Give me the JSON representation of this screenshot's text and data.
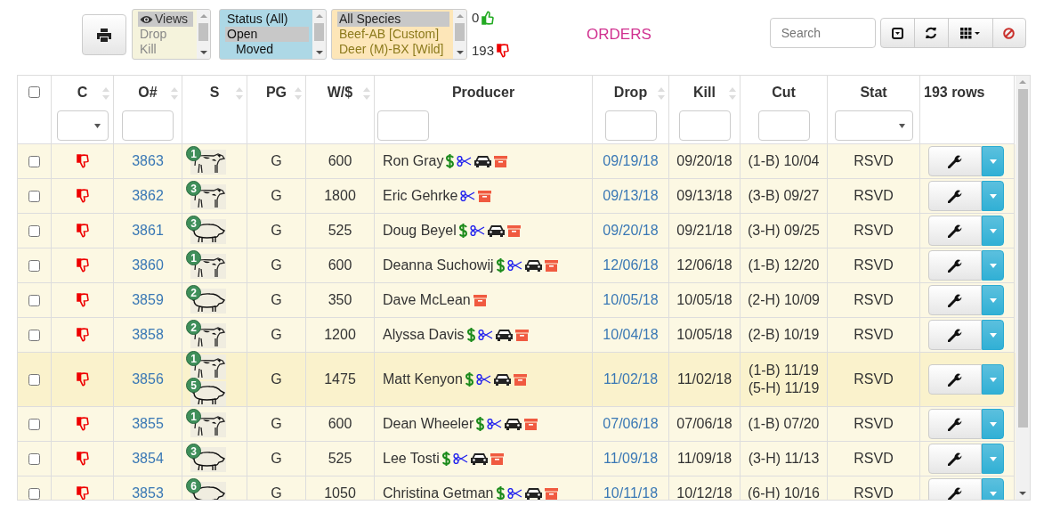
{
  "toolbar": {
    "views": [
      {
        "label": "Views",
        "selected": true
      },
      {
        "label": "Drop",
        "selected": false
      },
      {
        "label": "Kill",
        "selected": false
      }
    ],
    "statuses": [
      {
        "label": "Status (All)",
        "selected": false,
        "indented": false
      },
      {
        "label": "Open",
        "selected": true,
        "indented": false
      },
      {
        "label": "Moved",
        "selected": false,
        "indented": true
      }
    ],
    "species": [
      {
        "label": "All Species",
        "selected": true
      },
      {
        "label": "Beef-AB [Custom]",
        "selected": false
      },
      {
        "label": "Deer (M)-BX [Wild]",
        "selected": false
      }
    ],
    "approved_count": "0",
    "rejected_count": "193",
    "title": "ORDERS",
    "search": {
      "placeholder": "Search"
    }
  },
  "table": {
    "select_all": {
      "checked": false
    },
    "columns": [
      {
        "label": "C",
        "sortable": true,
        "filter": {
          "kind": "select"
        }
      },
      {
        "label": "O#",
        "sortable": true,
        "filter": {
          "kind": "text"
        }
      },
      {
        "label": "S",
        "sortable": true
      },
      {
        "label": "PG",
        "sortable": true
      },
      {
        "label": "W/$",
        "sortable": true
      },
      {
        "label": "Producer",
        "sortable": false,
        "filter": {
          "kind": "text"
        }
      },
      {
        "label": "Drop",
        "sortable": true,
        "filter": {
          "kind": "text"
        }
      },
      {
        "label": "Kill",
        "sortable": true,
        "filter": {
          "kind": "text"
        }
      },
      {
        "label": "Cut",
        "sortable": false,
        "filter": {
          "kind": "text"
        }
      },
      {
        "label": "Stat",
        "sortable": false,
        "filter": {
          "kind": "select"
        }
      },
      {
        "label": "193 rows",
        "sortable": false
      }
    ],
    "rows": [
      {
        "checked": false,
        "highlighted": false,
        "order": "3863",
        "animals": [
          {
            "kind": "cow",
            "count": "1"
          }
        ],
        "pg": "G",
        "weight": "600",
        "producer": "Ron Gray",
        "flags": {
          "dollar": true,
          "scissors": true,
          "car": true,
          "box": true
        },
        "drop": "09/19/18",
        "kill": "09/20/18",
        "cuts": [
          "(1-B) 10/04"
        ],
        "stat": "RSVD"
      },
      {
        "checked": false,
        "highlighted": false,
        "order": "3862",
        "animals": [
          {
            "kind": "cow",
            "count": "3"
          }
        ],
        "pg": "G",
        "weight": "1800",
        "producer": "Eric Gehrke",
        "flags": {
          "dollar": false,
          "scissors": true,
          "car": false,
          "box": true
        },
        "drop": "09/13/18",
        "kill": "09/13/18",
        "cuts": [
          "(3-B) 09/27"
        ],
        "stat": "RSVD"
      },
      {
        "checked": false,
        "highlighted": false,
        "order": "3861",
        "animals": [
          {
            "kind": "pig",
            "count": "3"
          }
        ],
        "pg": "G",
        "weight": "525",
        "producer": "Doug Beyel",
        "flags": {
          "dollar": true,
          "scissors": true,
          "car": true,
          "box": true
        },
        "drop": "09/20/18",
        "kill": "09/21/18",
        "cuts": [
          "(3-H) 09/25"
        ],
        "stat": "RSVD"
      },
      {
        "checked": false,
        "highlighted": false,
        "order": "3860",
        "animals": [
          {
            "kind": "cow",
            "count": "1"
          }
        ],
        "pg": "G",
        "weight": "600",
        "producer": "Deanna Suchowij",
        "flags": {
          "dollar": true,
          "scissors": true,
          "car": true,
          "box": true
        },
        "drop": "12/06/18",
        "kill": "12/06/18",
        "cuts": [
          "(1-B) 12/20"
        ],
        "stat": "RSVD"
      },
      {
        "checked": false,
        "highlighted": false,
        "order": "3859",
        "animals": [
          {
            "kind": "pig",
            "count": "2"
          }
        ],
        "pg": "G",
        "weight": "350",
        "producer": "Dave McLean",
        "flags": {
          "dollar": false,
          "scissors": false,
          "car": false,
          "box": true
        },
        "drop": "10/05/18",
        "kill": "10/05/18",
        "cuts": [
          "(2-H) 10/09"
        ],
        "stat": "RSVD"
      },
      {
        "checked": false,
        "highlighted": false,
        "order": "3858",
        "animals": [
          {
            "kind": "cow",
            "count": "2"
          }
        ],
        "pg": "G",
        "weight": "1200",
        "producer": "Alyssa Davis",
        "flags": {
          "dollar": true,
          "scissors": true,
          "car": true,
          "box": true
        },
        "drop": "10/04/18",
        "kill": "10/05/18",
        "cuts": [
          "(2-B) 10/19"
        ],
        "stat": "RSVD"
      },
      {
        "checked": false,
        "highlighted": true,
        "order": "3856",
        "animals": [
          {
            "kind": "cow",
            "count": "1"
          },
          {
            "kind": "pig",
            "count": "5"
          }
        ],
        "pg": "G",
        "weight": "1475",
        "producer": "Matt Kenyon",
        "flags": {
          "dollar": true,
          "scissors": true,
          "car": true,
          "box": true
        },
        "drop": "11/02/18",
        "kill": "11/02/18",
        "cuts": [
          "(1-B) 11/19",
          "(5-H) 11/19"
        ],
        "stat": "RSVD"
      },
      {
        "checked": false,
        "highlighted": false,
        "order": "3855",
        "animals": [
          {
            "kind": "cow",
            "count": "1"
          }
        ],
        "pg": "G",
        "weight": "600",
        "producer": "Dean Wheeler",
        "flags": {
          "dollar": true,
          "scissors": true,
          "car": true,
          "box": true
        },
        "drop": "07/06/18",
        "kill": "07/06/18",
        "cuts": [
          "(1-B) 07/20"
        ],
        "stat": "RSVD"
      },
      {
        "checked": false,
        "highlighted": false,
        "order": "3854",
        "animals": [
          {
            "kind": "pig",
            "count": "3"
          }
        ],
        "pg": "G",
        "weight": "525",
        "producer": "Lee Tosti",
        "flags": {
          "dollar": true,
          "scissors": true,
          "car": true,
          "box": true
        },
        "drop": "11/09/18",
        "kill": "11/09/18",
        "cuts": [
          "(3-H) 11/13"
        ],
        "stat": "RSVD"
      },
      {
        "checked": false,
        "highlighted": false,
        "order": "3853",
        "animals": [
          {
            "kind": "pig",
            "count": "6"
          }
        ],
        "pg": "G",
        "weight": "1050",
        "producer": "Christina Getman",
        "flags": {
          "dollar": true,
          "scissors": true,
          "car": true,
          "box": true
        },
        "drop": "10/11/18",
        "kill": "10/12/18",
        "cuts": [
          "(6-H) 10/16"
        ],
        "stat": "RSVD"
      }
    ]
  }
}
